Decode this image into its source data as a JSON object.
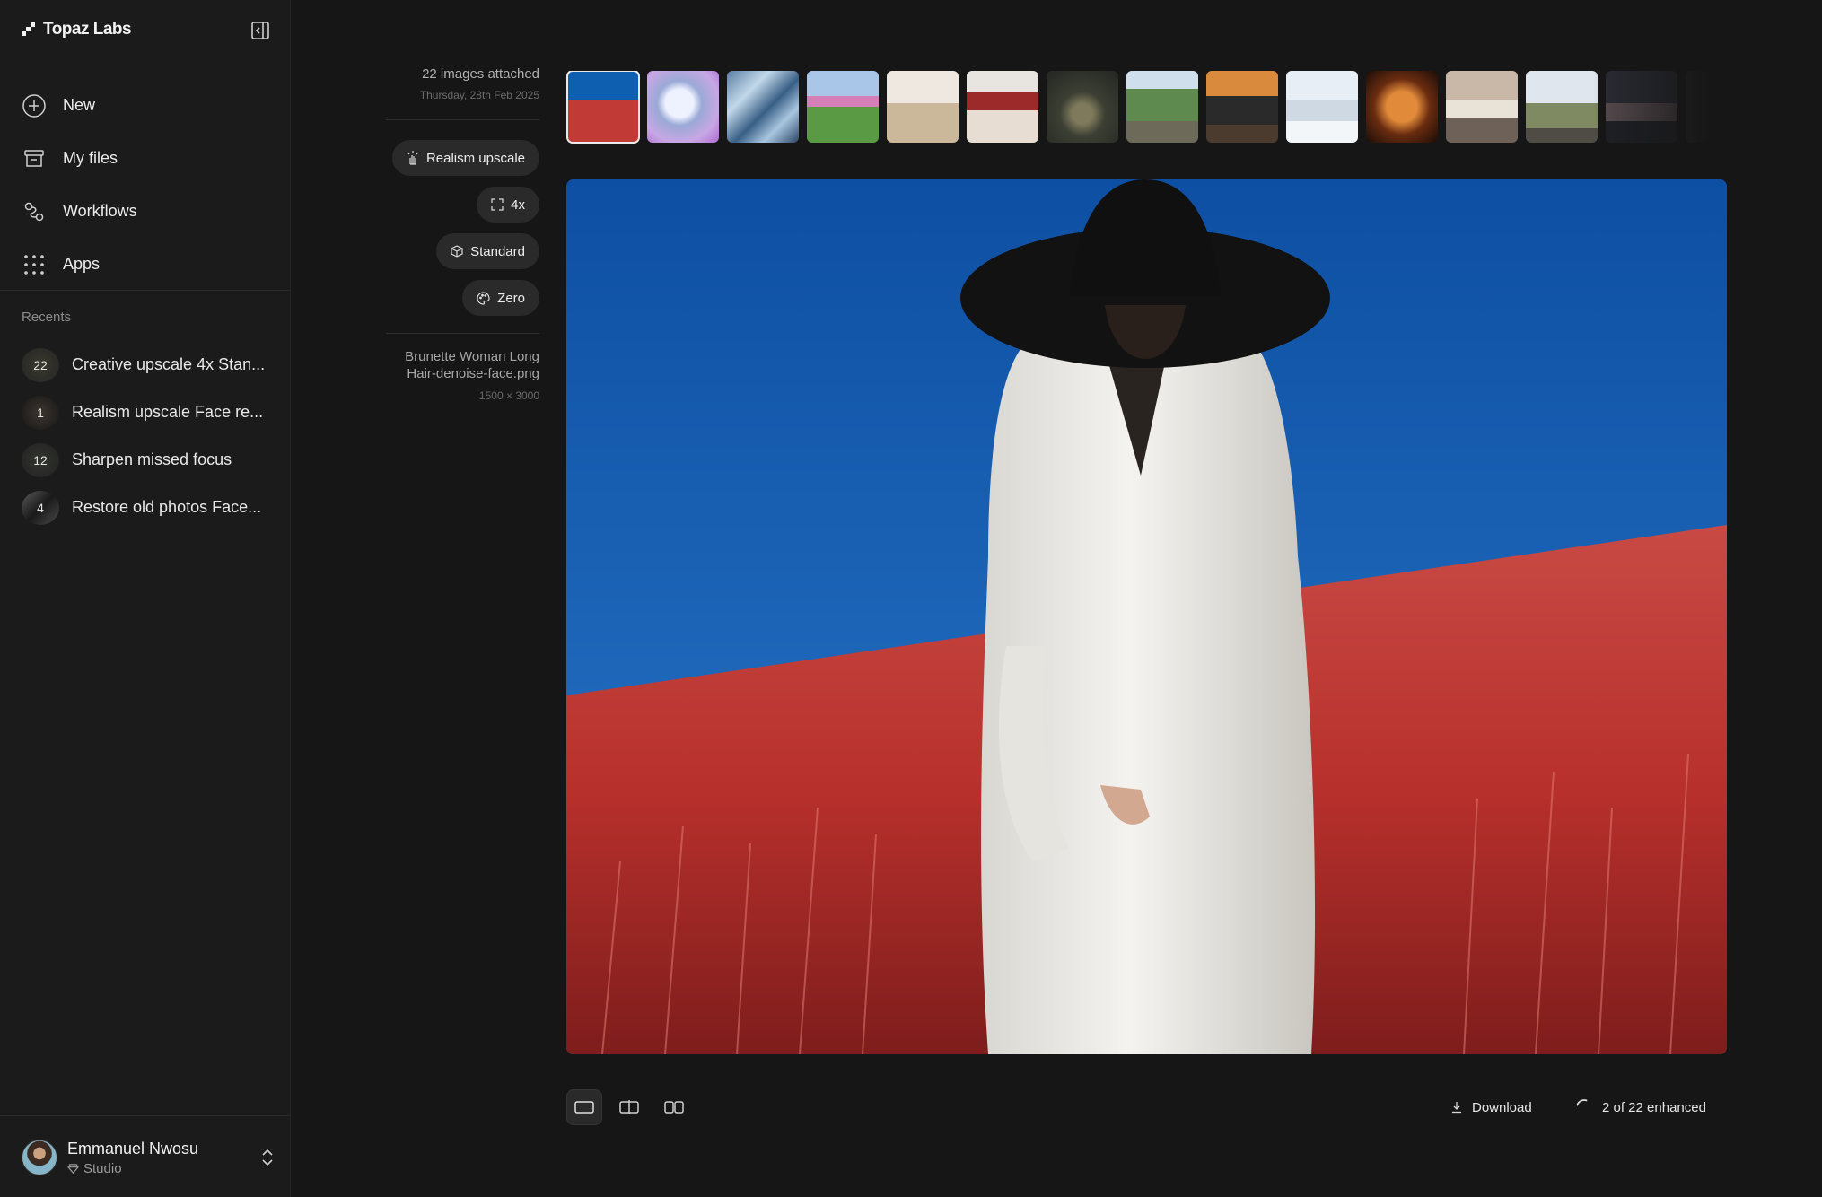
{
  "brand": {
    "name": "Topaz Labs"
  },
  "sidebar": {
    "nav": [
      {
        "label": "New",
        "icon": "plus-icon"
      },
      {
        "label": "My files",
        "icon": "archive-icon"
      },
      {
        "label": "Workflows",
        "icon": "workflow-icon"
      },
      {
        "label": "Apps",
        "icon": "grid-icon"
      }
    ],
    "recents_title": "Recents",
    "recents": [
      {
        "badge": "22",
        "label": "Creative upscale 4x Stan..."
      },
      {
        "badge": "1",
        "label": "Realism upscale Face re..."
      },
      {
        "badge": "12",
        "label": "Sharpen missed focus"
      },
      {
        "badge": "4",
        "label": "Restore old photos Face..."
      }
    ],
    "user": {
      "name": "Emmanuel Nwosu",
      "plan": "Studio"
    }
  },
  "info": {
    "attached": "22 images attached",
    "date": "Thursday, 28th Feb 2025",
    "chips": [
      {
        "label": "Realism upscale",
        "icon": "sparkle-hand-icon"
      },
      {
        "label": "4x",
        "icon": "expand-icon"
      },
      {
        "label": "Standard",
        "icon": "cube-icon"
      },
      {
        "label": "Zero",
        "icon": "palette-icon"
      }
    ],
    "file_name_line1": "Brunette Woman Long",
    "file_name_line2": "Hair-denoise-face.png",
    "file_dimensions": "1500 × 3000"
  },
  "thumbnails_count": 15,
  "selected_thumbnail": 1,
  "bottom": {
    "download_label": "Download",
    "progress_label": "2 of 22 enhanced",
    "enhanced": 2,
    "total": 22
  },
  "colors": {
    "background": "#161616",
    "sidebar": "#1b1b1b",
    "chip": "#2a2a2a",
    "sky": "#1b5fb4",
    "field": "#c23a35"
  }
}
